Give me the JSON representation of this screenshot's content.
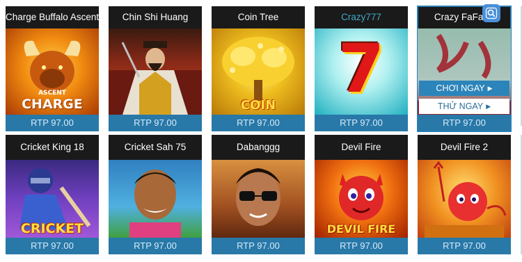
{
  "games": [
    {
      "title": "Charge Buffalo Ascent",
      "rtp": "RTP 97.00",
      "art_label": "ASCENT",
      "art_label2": "CHARGE"
    },
    {
      "title": "Chin Shi Huang",
      "rtp": "RTP 97.00"
    },
    {
      "title": "Coin Tree",
      "rtp": "RTP 97.00",
      "art_label": "COIN"
    },
    {
      "title": "Crazy777",
      "rtp": "RTP 97.00",
      "art_label": "7"
    },
    {
      "title": "Crazy FaFaFa",
      "rtp": "RTP 97.00"
    },
    {
      "title": "Cricket King 18",
      "rtp": "RTP 97.00",
      "art_label": "CRICKET"
    },
    {
      "title": "Cricket Sah 75",
      "rtp": "RTP 97.00"
    },
    {
      "title": "Dabanggg",
      "rtp": "RTP 97.00"
    },
    {
      "title": "Devil Fire",
      "rtp": "RTP 97.00",
      "art_label": "DEVIL FIRE"
    },
    {
      "title": "Devil Fire 2",
      "rtp": "RTP 97.00"
    }
  ],
  "active_card": {
    "play_label": "CHƠI NGAY",
    "try_label": "THỬ NGAY"
  },
  "icons": {
    "search": "search-icon",
    "arrow": "play-arrow-icon"
  },
  "colors": {
    "rtp_bar": "#2878a8",
    "title_bar": "#1a1a1a",
    "play_button": "#2b84ba",
    "try_button": "#ffffff"
  }
}
